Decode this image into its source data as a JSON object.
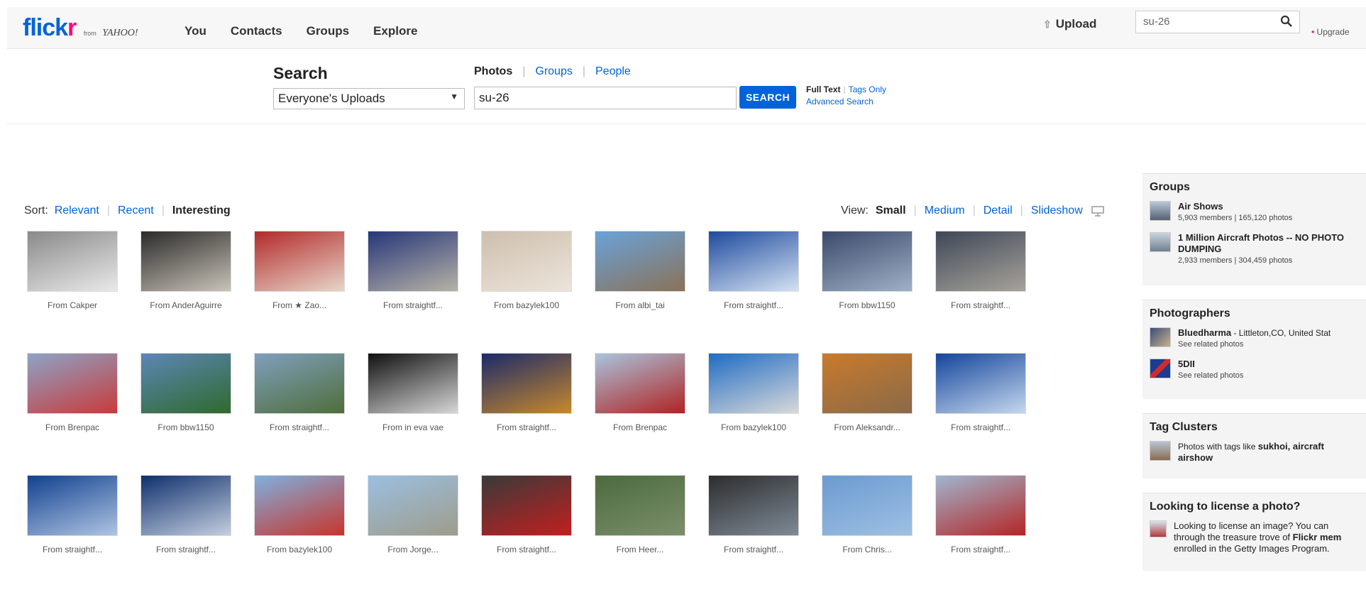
{
  "header": {
    "logo_flickr_blue": "flick",
    "logo_flickr_pink": "r",
    "logo_from": "from",
    "logo_yahoo": "YAHOO!",
    "nav": [
      "You",
      "Contacts",
      "Groups",
      "Explore"
    ],
    "upload": "Upload",
    "search_value": "su-26",
    "upgrade": "Upgrade"
  },
  "search": {
    "title": "Search",
    "scope": "Everyone's Uploads",
    "tabs": [
      "Photos",
      "Groups",
      "People"
    ],
    "query": "su-26",
    "button": "SEARCH",
    "full_text": "Full Text",
    "tags_only": "Tags Only",
    "advanced": "Advanced Search"
  },
  "sort": {
    "label": "Sort:",
    "options": [
      "Relevant",
      "Recent",
      "Interesting"
    ]
  },
  "view": {
    "label": "View:",
    "options": [
      "Small",
      "Medium",
      "Detail",
      "Slideshow"
    ]
  },
  "photos": [
    {
      "caption": "From Cakper",
      "colors": [
        "#8a8a8a",
        "#e9e9e9"
      ]
    },
    {
      "caption": "From AnderAguirre",
      "colors": [
        "#2a2a2a",
        "#c9c3b8"
      ]
    },
    {
      "caption": "From ★ Zao...",
      "colors": [
        "#b32a2a",
        "#e7d5c9"
      ]
    },
    {
      "caption": "From straightf...",
      "colors": [
        "#26367a",
        "#b7b2a6"
      ]
    },
    {
      "caption": "From bazylek100",
      "colors": [
        "#cdbfae",
        "#ece4da"
      ]
    },
    {
      "caption": "From albi_tai",
      "colors": [
        "#6aa2d9",
        "#8a7258"
      ]
    },
    {
      "caption": "From straightf...",
      "colors": [
        "#1e4a9e",
        "#d4e2f3"
      ]
    },
    {
      "caption": "From bbw1150",
      "colors": [
        "#3b4a6b",
        "#9fb0c6"
      ]
    },
    {
      "caption": "From straightf...",
      "colors": [
        "#3f4756",
        "#a7a39b"
      ]
    },
    {
      "caption": "From Brenpac",
      "colors": [
        "#8da3c7",
        "#c83b3b"
      ]
    },
    {
      "caption": "From bbw1150",
      "colors": [
        "#5d86b7",
        "#2f6a2d"
      ]
    },
    {
      "caption": "From straightf...",
      "colors": [
        "#7f9fbd",
        "#4f6e3c"
      ]
    },
    {
      "caption": "From in eva vae",
      "colors": [
        "#111111",
        "#d7d7d7"
      ]
    },
    {
      "caption": "From straightf...",
      "colors": [
        "#1b2b6a",
        "#c8882c"
      ]
    },
    {
      "caption": "From Brenpac",
      "colors": [
        "#a9c4dd",
        "#b02323"
      ]
    },
    {
      "caption": "From bazylek100",
      "colors": [
        "#1f6cc4",
        "#d9d9d9"
      ]
    },
    {
      "caption": "From Aleksandr...",
      "colors": [
        "#c97a2a",
        "#8a6a4a"
      ]
    },
    {
      "caption": "From straightf...",
      "colors": [
        "#14459c",
        "#c5d7ee"
      ]
    },
    {
      "caption": "From straightf...",
      "colors": [
        "#12418f",
        "#aec4e3"
      ]
    },
    {
      "caption": "From straightf...",
      "colors": [
        "#0f2f6d",
        "#c4cfe0"
      ]
    },
    {
      "caption": "From bazylek100",
      "colors": [
        "#7fb0de",
        "#c7352c"
      ]
    },
    {
      "caption": "From Jorge...",
      "colors": [
        "#9bbfe1",
        "#9e9c8b"
      ]
    },
    {
      "caption": "From straightf...",
      "colors": [
        "#3a3a3a",
        "#c21f1f"
      ]
    },
    {
      "caption": "From Heer...",
      "colors": [
        "#4b6b3e",
        "#7c8f6b"
      ]
    },
    {
      "caption": "From straightf...",
      "colors": [
        "#2d2d2d",
        "#7f8a96"
      ]
    },
    {
      "caption": "From Chris...",
      "colors": [
        "#6b9ad0",
        "#9fc0e3"
      ]
    },
    {
      "caption": "From straightf...",
      "colors": [
        "#9fb6cf",
        "#b42626"
      ]
    }
  ],
  "sidebar": {
    "groups": {
      "title": "Groups",
      "items": [
        {
          "name": "Air Shows",
          "meta": "5,903 members | 165,120 photos"
        },
        {
          "name": "1 Million Aircraft Photos -- NO PHOTO",
          "name2": "DUMPING",
          "meta": "2,933 members | 304,459 photos"
        }
      ]
    },
    "photographers": {
      "title": "Photographers",
      "items": [
        {
          "name": "Bluedharma",
          "location": " - Littleton,CO, United Stat",
          "meta": "See related photos"
        },
        {
          "name": "5DII",
          "location": "",
          "meta": "See related photos"
        }
      ]
    },
    "tag_clusters": {
      "title": "Tag Clusters",
      "prefix": "Photos with tags like ",
      "tags": "sukhoi, aircraft",
      "tags2": "airshow"
    },
    "license": {
      "title": "Looking to license a photo?",
      "line1": "Looking to license an image? You can",
      "line2a": "through the treasure trove of ",
      "line2b": "Flickr mem",
      "line3": "enrolled in the Getty Images Program."
    }
  }
}
